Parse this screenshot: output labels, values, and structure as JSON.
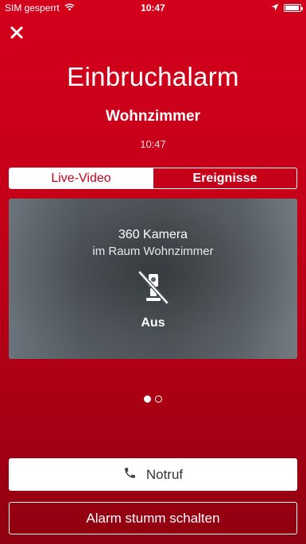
{
  "status_bar": {
    "carrier": "SIM gesperrt",
    "time": "10:47",
    "icons": [
      "wifi-icon",
      "location-arrow-icon",
      "battery-icon"
    ]
  },
  "alarm": {
    "close_icon": "close-icon",
    "title": "Einbruchalarm",
    "room": "Wohnzimmer",
    "time": "10:47"
  },
  "tabs": [
    {
      "label": "Live-Video",
      "active": true
    },
    {
      "label": "Ereignisse",
      "active": false
    }
  ],
  "camera": {
    "name": "360 Kamera",
    "location": "im Raum Wohnzimmer",
    "icon": "camera-off-icon",
    "status": "Aus"
  },
  "pager": {
    "page_count": 2,
    "current_page": 1
  },
  "actions": {
    "emergency_label": "Notruf",
    "emergency_icon": "phone-icon",
    "mute_label": "Alarm stumm schalten"
  },
  "colors": {
    "accent": "#c8001a",
    "background_top": "#d3001b",
    "background_bottom": "#8f0010"
  }
}
